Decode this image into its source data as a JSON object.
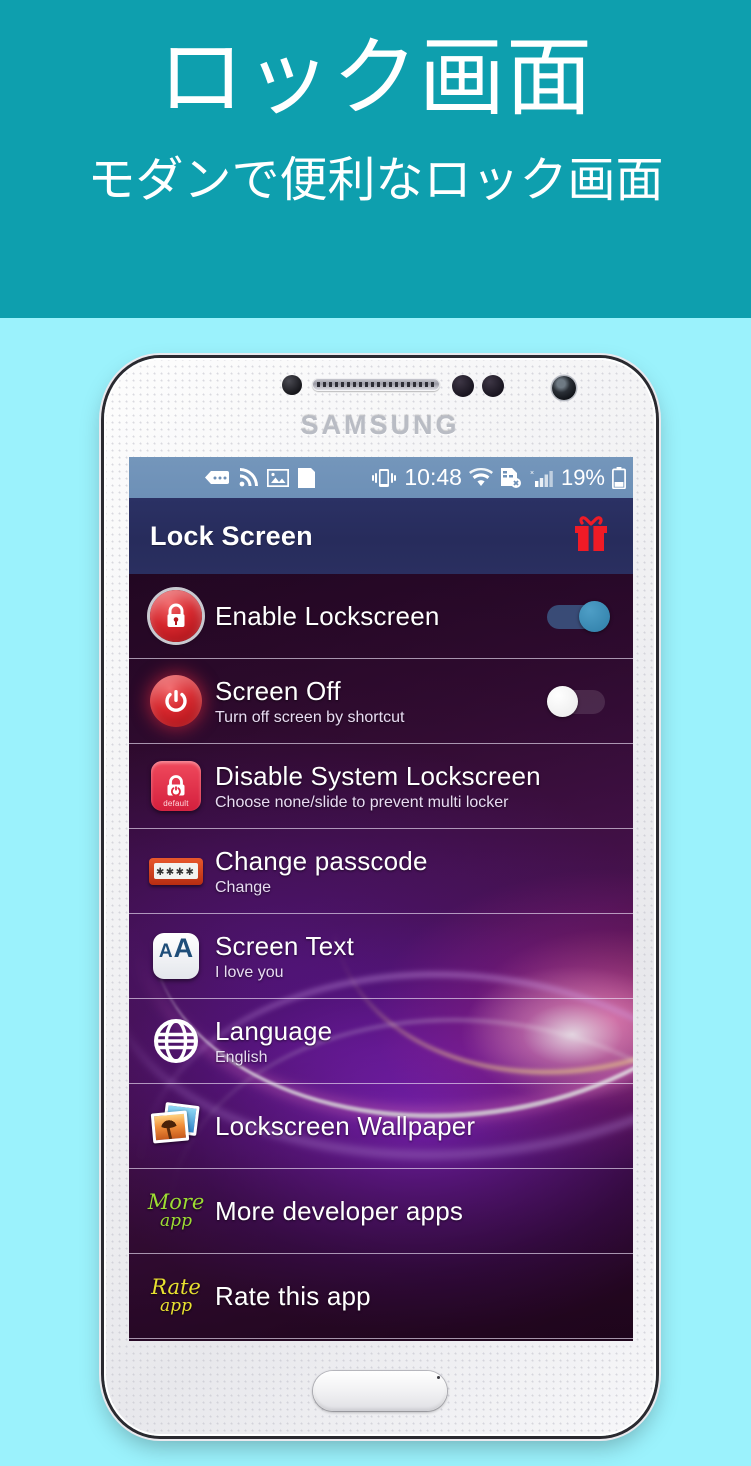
{
  "banner": {
    "title": "ロック画面",
    "subtitle": "モダンで便利なロック画面"
  },
  "phone": {
    "brand": "SAMSUNG"
  },
  "statusbar": {
    "time": "10:48",
    "battery_percent": "19%",
    "icons_left": [
      "message-icon",
      "rss-icon",
      "image-icon",
      "sdcard-icon"
    ],
    "icons_right": [
      "vibrate-icon",
      "wifi-icon",
      "sim-error-icon",
      "signal-bars-icon",
      "battery-icon"
    ]
  },
  "appbar": {
    "title": "Lock Screen",
    "gift_icon": "gift-icon",
    "background": "#272c5c"
  },
  "theme": {
    "banner_bg": "#0e9fae",
    "page_bg": "#9bf2fc",
    "toggle_on": "#3f8cb8",
    "accent_red": "#d5262c"
  },
  "settings": [
    {
      "id": "enable-lockscreen",
      "icon": "lock-circle-icon",
      "title": "Enable Lockscreen",
      "subtitle": "",
      "control": "toggle",
      "toggle_state": "on"
    },
    {
      "id": "screen-off",
      "icon": "power-circle-icon",
      "title": "Screen Off",
      "subtitle": "Turn off screen by shortcut",
      "control": "toggle",
      "toggle_state": "off"
    },
    {
      "id": "disable-system-lockscreen",
      "icon": "lock-default-icon",
      "icon_label": "default",
      "title": "Disable System Lockscreen",
      "subtitle": "Choose none/slide to prevent multi locker",
      "control": "none"
    },
    {
      "id": "change-passcode",
      "icon": "passcode-icon",
      "icon_text": "✱✱✱✱",
      "title": "Change passcode",
      "subtitle": "Change",
      "control": "none"
    },
    {
      "id": "screen-text",
      "icon": "text-size-icon",
      "icon_text_small": "A",
      "icon_text_large": "A",
      "title": "Screen Text",
      "subtitle": "I love you",
      "control": "none"
    },
    {
      "id": "language",
      "icon": "globe-icon",
      "title": "Language",
      "subtitle": "English",
      "control": "none"
    },
    {
      "id": "lockscreen-wallpaper",
      "icon": "photos-icon",
      "title": "Lockscreen Wallpaper",
      "subtitle": "",
      "control": "none"
    },
    {
      "id": "more-developer-apps",
      "icon": "more-app-icon",
      "icon_line1": "More",
      "icon_line2": "app",
      "title": "More developer apps",
      "subtitle": "",
      "control": "none"
    },
    {
      "id": "rate-this-app",
      "icon": "rate-app-icon",
      "icon_line1": "Rate",
      "icon_line2": "app",
      "title": "Rate this app",
      "subtitle": "",
      "control": "none"
    }
  ]
}
